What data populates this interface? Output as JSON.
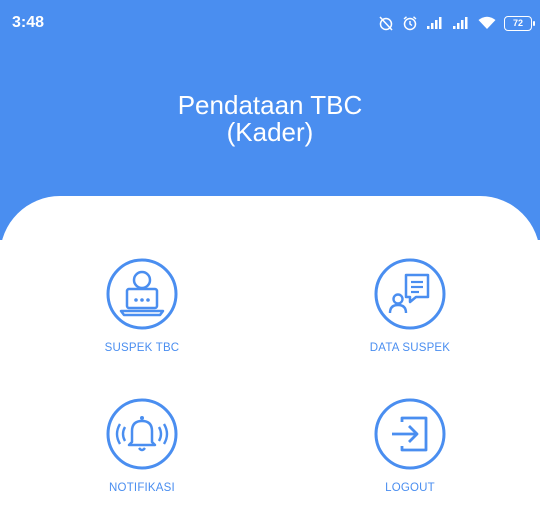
{
  "status_bar": {
    "time": "3:48",
    "battery": "72",
    "icons": [
      "alarm-off-icon",
      "alarm-icon",
      "signal-icon",
      "signal-icon",
      "wifi-icon",
      "battery-icon"
    ]
  },
  "header": {
    "title_line1": "Pendataan TBC",
    "title_line2": "(Kader)"
  },
  "menu": {
    "suspek_tbc": "SUSPEK TBC",
    "data_suspek": "DATA SUSPEK",
    "notifikasi": "NOTIFIKASI",
    "logout": "LOGOUT"
  },
  "colors": {
    "primary": "#4a8ef0",
    "background": "#ffffff"
  }
}
